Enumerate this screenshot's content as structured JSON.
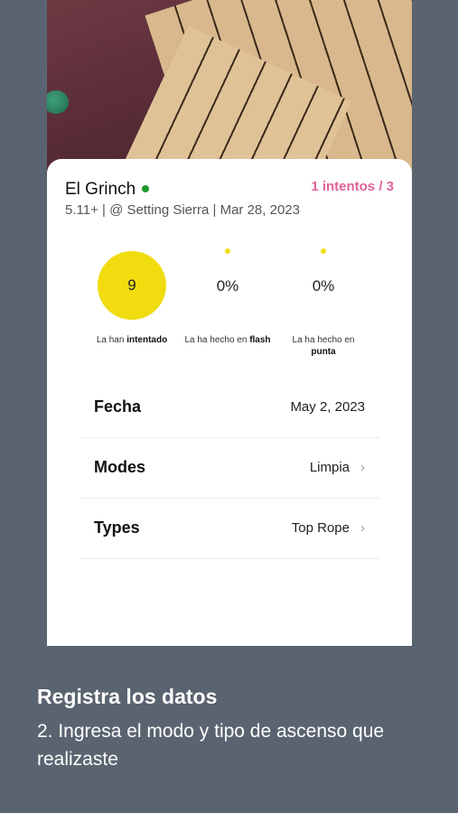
{
  "route": {
    "name": "El Grinch",
    "status_color": "#1e9a2c",
    "attempts": "1 intentos / 3",
    "meta": "5.11+ | @ Setting Sierra | Mar 28, 2023"
  },
  "stats": [
    {
      "value": "9",
      "label_prefix": "La han ",
      "label_bold": "intentado"
    },
    {
      "value": "0%",
      "label_prefix": "La ha hecho en ",
      "label_bold": "flash"
    },
    {
      "value": "0%",
      "label_prefix": "La ha hecho en",
      "label_bold": "punta"
    }
  ],
  "fields": [
    {
      "label": "Fecha",
      "value": "May 2, 2023",
      "chevron": false
    },
    {
      "label": "Modes",
      "value": "Limpia",
      "chevron": true
    },
    {
      "label": "Types",
      "value": "Top Rope",
      "chevron": true
    }
  ],
  "caption": {
    "title": "Registra los datos",
    "text": "2. Ingresa el modo y tipo de ascenso que realizaste"
  },
  "colors": {
    "background": "#5a6470",
    "accent_pink": "#e0609a",
    "stat_yellow": "#f0dc0f"
  }
}
